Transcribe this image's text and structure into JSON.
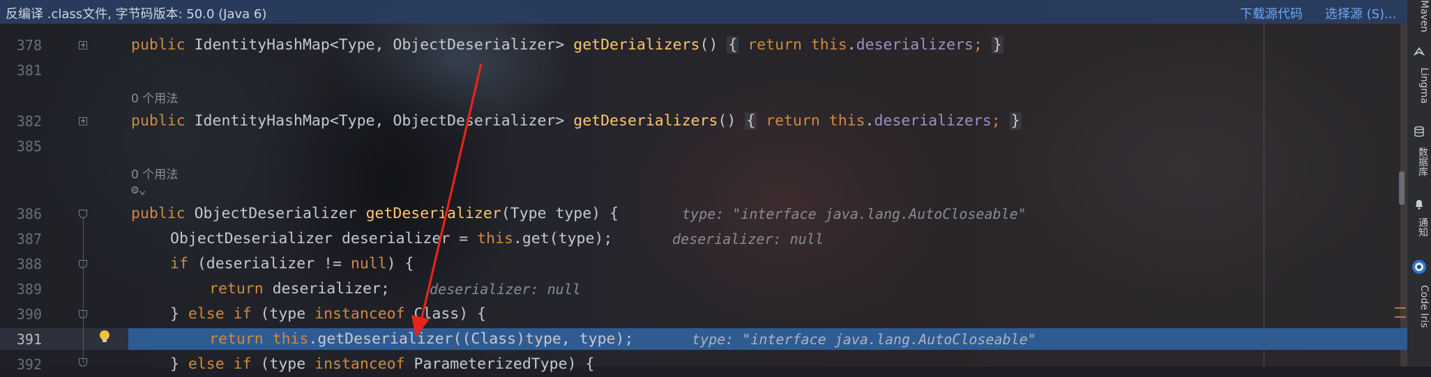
{
  "banner": {
    "text": "反编译 .class文件, 字节码版本: 50.0 (Java 6)",
    "download_label": "下载源代码",
    "choose_label": "选择源 (S)..."
  },
  "right_toolbar": {
    "maven": "Maven",
    "lingma": "Lingma",
    "database": "数据库",
    "notifications": "通知",
    "code_iris": "Code Iris"
  },
  "gutter": {
    "line_numbers": [
      "378",
      "381",
      "382",
      "385",
      "386",
      "387",
      "388",
      "389",
      "390",
      "391",
      "392"
    ]
  },
  "usages": {
    "usage_1": "0 个用法",
    "usage_2": "0 个用法"
  },
  "code": {
    "l378": {
      "kw_public": "public",
      "type": " IdentityHashMap<Type, ObjectDeserializer> ",
      "fn": "getDerializers",
      "paren": "() ",
      "ob": "{",
      "kw_return": " return ",
      "kw_this": "this",
      "dot": ".",
      "fld": "deserializers",
      "semi": "; ",
      "cb": "}"
    },
    "l382": {
      "kw_public": "public",
      "type": " IdentityHashMap<Type, ObjectDeserializer> ",
      "fn": "getDeserializers",
      "paren": "() ",
      "ob": "{",
      "kw_return": " return ",
      "kw_this": "this",
      "dot": ".",
      "fld": "deserializers",
      "semi": "; ",
      "cb": "}"
    },
    "l386": {
      "kw_public": "public",
      "type": " ObjectDeserializer ",
      "fn": "getDeserializer",
      "rest": "(Type type) {",
      "hint": "type: \"interface java.lang.AutoCloseable\""
    },
    "l387": {
      "pre": "ObjectDeserializer deserializer = ",
      "kw_this": "this",
      "rest": ".get(type);",
      "hint": "deserializer: null"
    },
    "l388": {
      "kw_if": "if",
      "pre": " (deserializer != ",
      "kw_null": "null",
      "rest": ") {"
    },
    "l389": {
      "kw_return": "return",
      "rest": " deserializer;",
      "hint": "deserializer: null"
    },
    "l390": {
      "pre": "} ",
      "kw_else": "else",
      "sp": " ",
      "kw_if": "if",
      "mid": " (type ",
      "kw_instanceof": "instanceof",
      "rest": " Class) {"
    },
    "l391": {
      "kw_return": "return",
      "sp": " ",
      "kw_this": "this",
      "rest": ".getDeserializer((Class)type, type);",
      "hint": "type: \"interface java.lang.AutoCloseable\""
    },
    "l392": {
      "pre": "} ",
      "kw_else": "else",
      "sp": " ",
      "kw_if": "if",
      "mid": " (type ",
      "kw_instanceof": "instanceof",
      "rest": " ParameterizedType) {"
    }
  },
  "colors": {
    "keyword": "#d08a3e",
    "method": "#ffc66d",
    "field": "#a28ec4",
    "current_line": "#2f5b93",
    "link": "#6fa8f0",
    "annotation_arrow": "#e8231c"
  }
}
